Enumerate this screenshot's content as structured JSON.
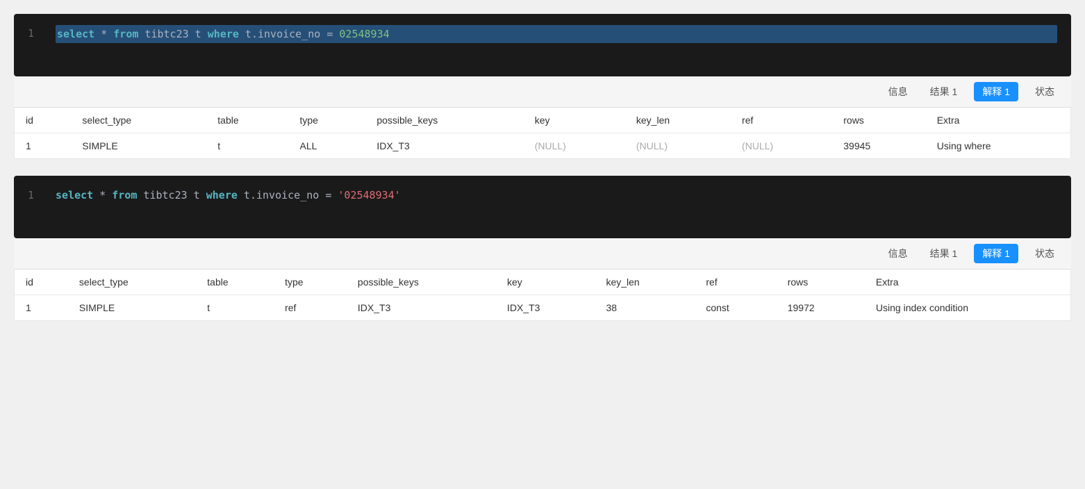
{
  "ui": {
    "colors": {
      "active_tab": "#1890ff",
      "code_bg": "#1a1a1a",
      "highlight_bg": "#264f78"
    },
    "section1": {
      "line_number": "1",
      "code": {
        "select": "select",
        "star": " * ",
        "from": "from",
        "table": " tibtc23 t ",
        "where": "where",
        "col": " t.invoice_no ",
        "op": " = ",
        "value": "02548934"
      },
      "tabs": [
        {
          "label": "信息",
          "active": false
        },
        {
          "label": "结果 1",
          "active": false
        },
        {
          "label": "解释 1",
          "active": true
        },
        {
          "label": "状态",
          "active": false
        }
      ],
      "table": {
        "headers": [
          "id",
          "select_type",
          "table",
          "type",
          "possible_keys",
          "key",
          "key_len",
          "ref",
          "rows",
          "Extra"
        ],
        "rows": [
          {
            "id": "1",
            "select_type": "SIMPLE",
            "table": "t",
            "type": "ALL",
            "possible_keys": "IDX_T3",
            "key": "(NULL)",
            "key_len": "(NULL)",
            "ref": "(NULL)",
            "rows": "39945",
            "extra": "Using where"
          }
        ]
      }
    },
    "section2": {
      "line_number": "1",
      "code": {
        "select": "select",
        "star": " * ",
        "from": "from",
        "table": " tibtc23 t ",
        "where": "where",
        "col": " t.invoice_no ",
        "op": " = ",
        "value": "'02548934'"
      },
      "tabs": [
        {
          "label": "信息",
          "active": false
        },
        {
          "label": "结果 1",
          "active": false
        },
        {
          "label": "解释 1",
          "active": true
        },
        {
          "label": "状态",
          "active": false
        }
      ],
      "table": {
        "headers": [
          "id",
          "select_type",
          "table",
          "type",
          "possible_keys",
          "key",
          "key_len",
          "ref",
          "rows",
          "Extra"
        ],
        "rows": [
          {
            "id": "1",
            "select_type": "SIMPLE",
            "table": "t",
            "type": "ref",
            "possible_keys": "IDX_T3",
            "key": "IDX_T3",
            "key_len": "38",
            "ref": "const",
            "rows": "19972",
            "extra": "Using index condition"
          }
        ]
      }
    }
  }
}
